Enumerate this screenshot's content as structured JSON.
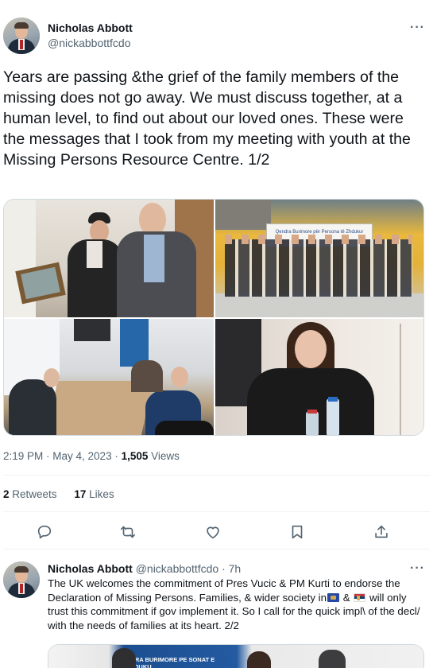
{
  "main_tweet": {
    "author_name": "Nicholas Abbott",
    "author_handle": "@nickabbottfcdo",
    "more_label": "···",
    "text": "Years are passing &the grief of the family members of the missing does not go away. We must discuss together, at a human level, to find out about our loved ones. These were the messages that I took from my meeting with youth at the Missing Persons Resource Centre. 1/2",
    "media": [
      {
        "icon": "photo-elderly-man-with-portrait"
      },
      {
        "icon": "photo-group-outside-centre",
        "sign_text": "Qendra Burimore për Persona të Zhdukur"
      },
      {
        "icon": "photo-meeting-table"
      },
      {
        "icon": "photo-young-woman-at-table"
      }
    ],
    "time": "2:19 PM",
    "date": "May 4, 2023",
    "separator": " · ",
    "views_count": "1,505",
    "views_label": " Views",
    "retweets_count": "2",
    "retweets_label": " Retweets",
    "likes_count": "17",
    "likes_label": " Likes",
    "actions": {
      "reply": "reply-icon",
      "retweet": "retweet-icon",
      "like": "heart-icon",
      "bookmark": "bookmark-icon",
      "share": "share-icon"
    }
  },
  "reply_tweet": {
    "author_name": "Nicholas Abbott",
    "author_handle": "@nickabbottfcdo",
    "age": "· 7h",
    "more_label": "···",
    "text_part1": "The UK welcomes the commitment of Pres Vucic & PM Kurti to endorse the Declaration of Missing Persons. Families, & wider society in",
    "text_between_flags": " & ",
    "text_part2": " will only trust this commitment if gov implement it. So I call for the quick impl\\ of the decl/ with the needs of families at its heart. 2/2",
    "flags": [
      "kosovo-flag",
      "serbia-flag"
    ],
    "media_text": "NURA BURIMORE PE SONAT E ZHDUKU"
  },
  "colors": {
    "text": "#0f1419",
    "secondary": "#536471",
    "divider": "#eff3f4",
    "border": "#cfd9de"
  }
}
